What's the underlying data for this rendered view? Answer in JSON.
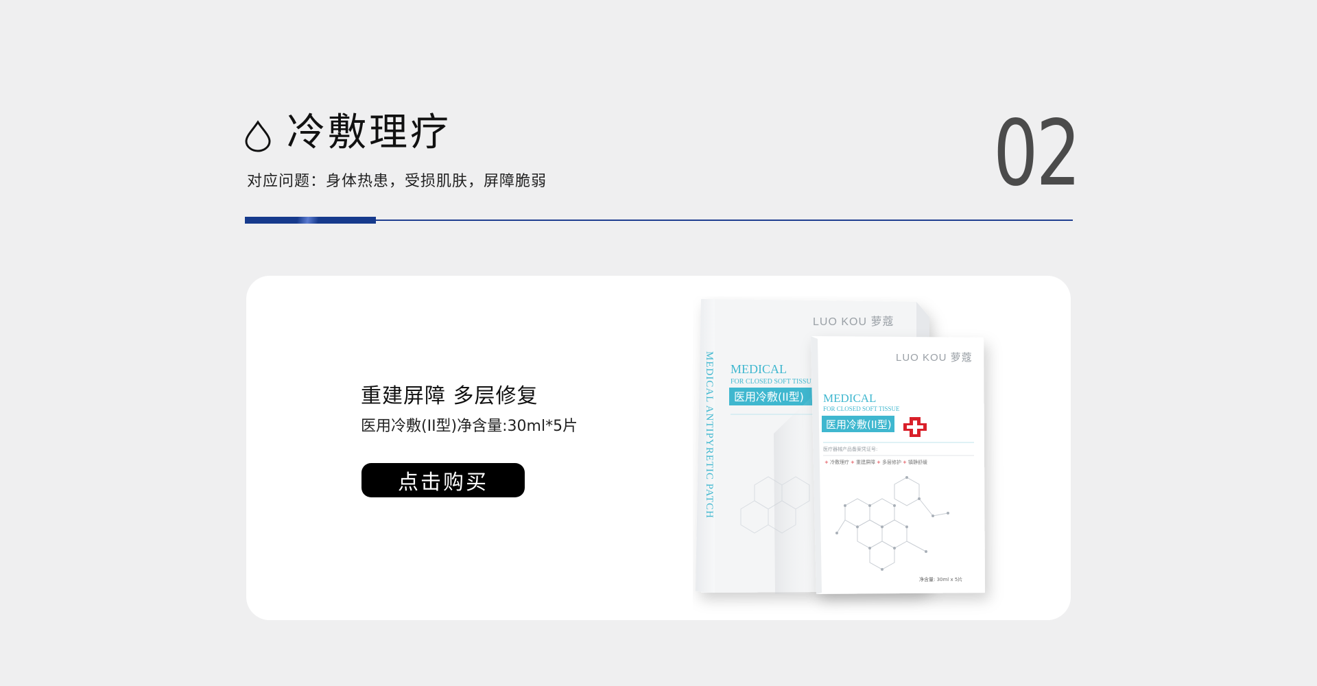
{
  "section": {
    "title": "冷敷理疗",
    "subtitle": "对应问题：身体热患，受损肌肤，屏障脆弱",
    "number": "02"
  },
  "product": {
    "heading": "重建屏障  多层修复",
    "spec": "医用冷敷(II型)净含量:30ml*5片",
    "buy_label": "点击购买",
    "box_side_text": "MEDICAL ANTIPYRETIC PATCH",
    "brand": "LUO KOU 萝蔻",
    "label_en_1": "MEDICAL",
    "label_en_2": "FOR CLOSED SOFT TISSUE",
    "label_cn": "医用冷敷(II型)",
    "registration": "医疗器械产品备案凭证号:",
    "features": [
      "冷敷理疗",
      "重建屏障",
      "多层修护",
      "镇静舒缓"
    ],
    "net_content": "净含量: 30ml x 5片"
  },
  "colors": {
    "accent_blue": "#1e3d8f",
    "label_cyan": "#3fb7cf",
    "cross_red": "#d9202a"
  }
}
